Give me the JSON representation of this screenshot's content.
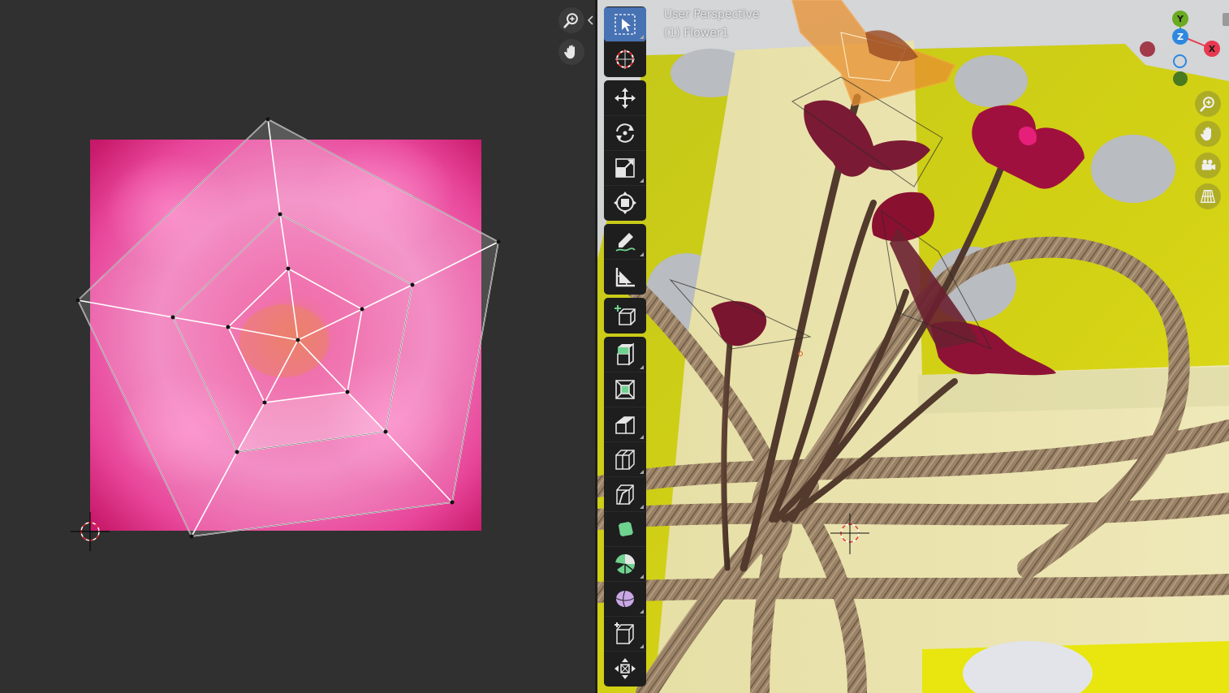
{
  "uv_editor": {
    "nav": [
      {
        "name": "zoom-icon"
      },
      {
        "name": "hand-pan-icon"
      }
    ],
    "collapse_icon": "chevron-left-icon",
    "texture_color": "#e0307a"
  },
  "viewport": {
    "view_label": "User Perspective",
    "object_label": "(1) Flower1",
    "gizmo": {
      "x_label": "X",
      "y_label": "Y",
      "z_label": "Z",
      "x_color": "#e8384f",
      "y_color": "#6bab22",
      "z_color": "#2e88e0"
    },
    "nav": [
      {
        "name": "zoom-icon"
      },
      {
        "name": "hand-pan-icon"
      },
      {
        "name": "camera-icon"
      },
      {
        "name": "grid-perspective-icon"
      }
    ]
  },
  "toolbar": {
    "active_color": "#4772b3",
    "tools": [
      "select-box-icon",
      "cursor-icon",
      "move-icon",
      "rotate-icon",
      "scale-icon",
      "transform-icon",
      "annotate-icon",
      "measure-icon",
      "add-cube-icon",
      "extrude-icon",
      "inset-icon",
      "bevel-icon",
      "loop-cut-icon",
      "knife-icon",
      "poly-build-icon",
      "spin-icon",
      "smooth-icon",
      "edge-slide-icon",
      "shrink-fatten-icon"
    ]
  }
}
